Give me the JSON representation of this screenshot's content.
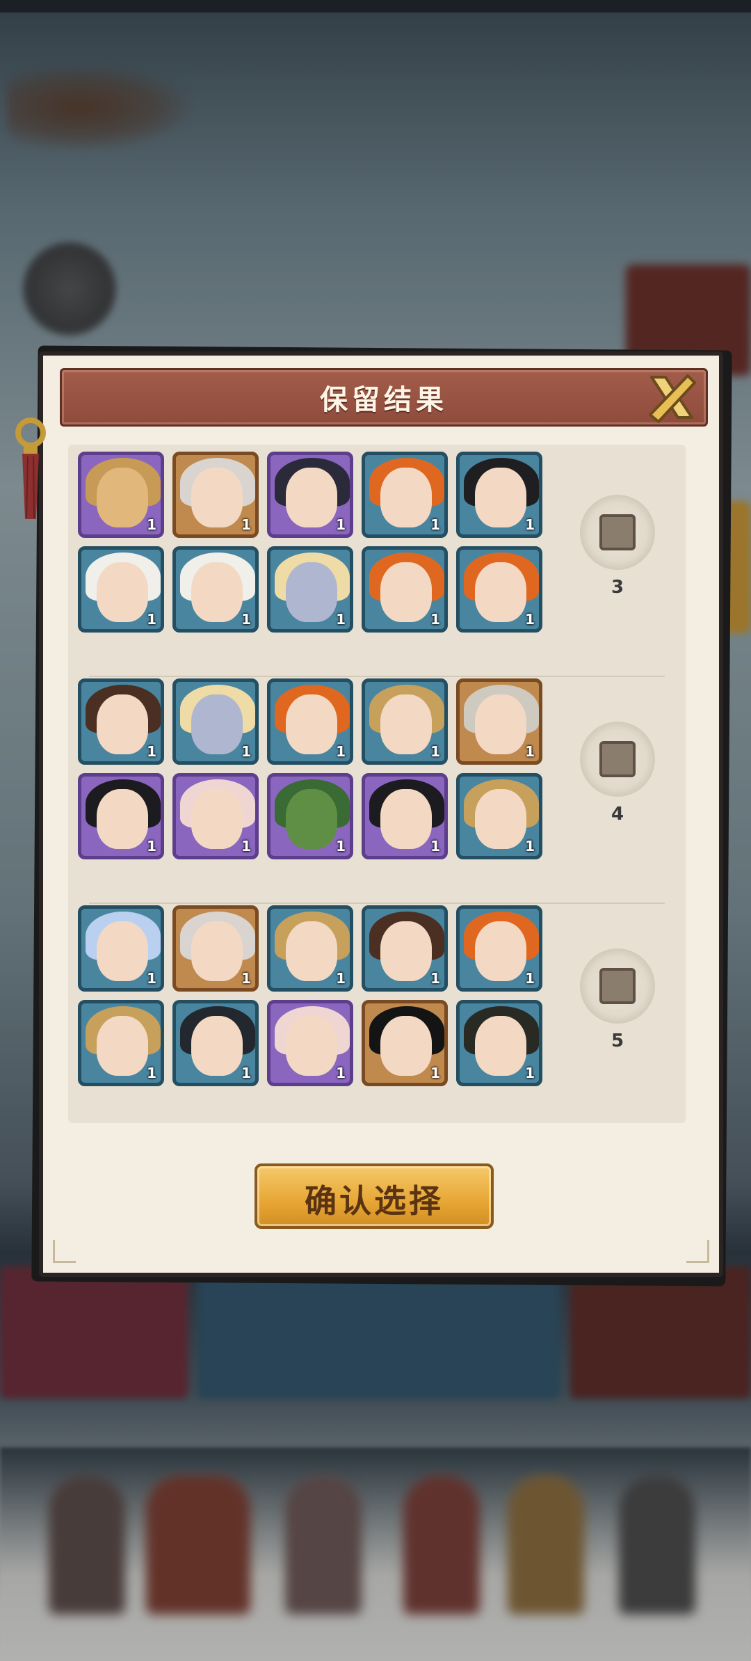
{
  "dialog": {
    "title": "保留结果",
    "confirm_label": "确认选择"
  },
  "groups": [
    {
      "label": "3",
      "cards": [
        {
          "frame": "purple",
          "count": "1",
          "portrait": "deer-portrait"
        },
        {
          "frame": "orange",
          "count": "1",
          "portrait": "silver-hair-girl-portrait"
        },
        {
          "frame": "purple",
          "count": "1",
          "portrait": "dark-hair-lady-portrait"
        },
        {
          "frame": "teal",
          "count": "1",
          "portrait": "orange-hair-girl-portrait"
        },
        {
          "frame": "teal",
          "count": "1",
          "portrait": "black-hair-man-portrait"
        },
        {
          "frame": "teal",
          "count": "1",
          "portrait": "white-hair-tiger-girl-portrait"
        },
        {
          "frame": "teal",
          "count": "1",
          "portrait": "white-hair-tiger-girl-portrait"
        },
        {
          "frame": "teal",
          "count": "1",
          "portrait": "blonde-blue-skin-portrait"
        },
        {
          "frame": "teal",
          "count": "1",
          "portrait": "orange-hair-girl-portrait"
        },
        {
          "frame": "teal",
          "count": "1",
          "portrait": "orange-hair-girl-portrait"
        }
      ]
    },
    {
      "label": "4",
      "cards": [
        {
          "frame": "teal",
          "count": "1",
          "portrait": "headband-youth-portrait"
        },
        {
          "frame": "teal",
          "count": "1",
          "portrait": "blonde-blue-skin-portrait"
        },
        {
          "frame": "teal",
          "count": "1",
          "portrait": "orange-hair-girl-portrait"
        },
        {
          "frame": "teal",
          "count": "1",
          "portrait": "blonde-warrior-portrait"
        },
        {
          "frame": "orange",
          "count": "1",
          "portrait": "silver-hair-man-portrait"
        },
        {
          "frame": "purple",
          "count": "1",
          "portrait": "black-hair-swordsman-portrait"
        },
        {
          "frame": "purple",
          "count": "1",
          "portrait": "pink-hair-girl-portrait"
        },
        {
          "frame": "purple",
          "count": "1",
          "portrait": "green-beast-portrait"
        },
        {
          "frame": "purple",
          "count": "1",
          "portrait": "black-hair-swordsman-portrait"
        },
        {
          "frame": "teal",
          "count": "1",
          "portrait": "blonde-warrior-portrait"
        }
      ]
    },
    {
      "label": "5",
      "cards": [
        {
          "frame": "teal",
          "count": "1",
          "portrait": "blue-hair-girl-portrait"
        },
        {
          "frame": "orange",
          "count": "1",
          "portrait": "silver-hair-girl-portrait"
        },
        {
          "frame": "teal",
          "count": "1",
          "portrait": "blonde-warrior-portrait"
        },
        {
          "frame": "teal",
          "count": "1",
          "portrait": "headband-youth-portrait"
        },
        {
          "frame": "teal",
          "count": "1",
          "portrait": "orange-hair-girl-portrait"
        },
        {
          "frame": "teal",
          "count": "1",
          "portrait": "blonde-warrior-portrait"
        },
        {
          "frame": "teal",
          "count": "1",
          "portrait": "dark-hair-youth-portrait"
        },
        {
          "frame": "purple",
          "count": "1",
          "portrait": "pink-hair-girl-portrait"
        },
        {
          "frame": "orange",
          "count": "1",
          "portrait": "long-black-hair-lady-portrait"
        },
        {
          "frame": "teal",
          "count": "1",
          "portrait": "green-headband-man-portrait"
        }
      ]
    }
  ],
  "colors": {
    "frame_purple": "#5d3e8c",
    "frame_orange": "#7a4b22",
    "frame_teal": "#244f63",
    "header_bg": "#9c5646",
    "confirm_bg": "#e7a634"
  }
}
